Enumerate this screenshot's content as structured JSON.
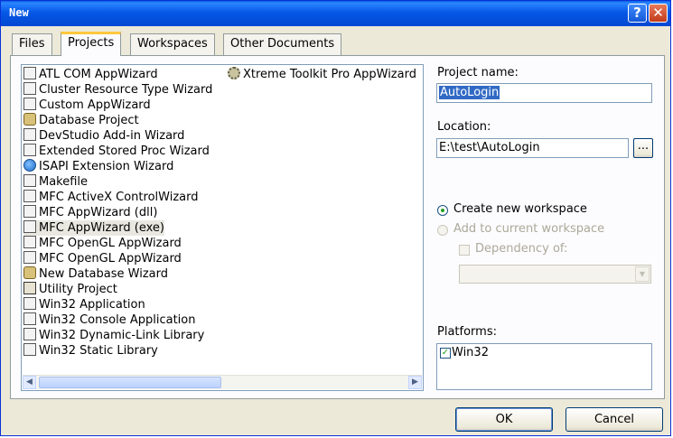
{
  "window": {
    "title": "New",
    "help_glyph": "?",
    "close_glyph": "✕"
  },
  "tabs": [
    {
      "label": "Files",
      "active": false
    },
    {
      "label": "Projects",
      "active": true
    },
    {
      "label": "Workspaces",
      "active": false
    },
    {
      "label": "Other Documents",
      "active": false
    }
  ],
  "project_types": [
    {
      "label": "ATL COM AppWizard",
      "icon": "atl-icon"
    },
    {
      "label": "Cluster Resource Type Wizard",
      "icon": "cluster-icon"
    },
    {
      "label": "Custom AppWizard",
      "icon": "custom-wizard-icon"
    },
    {
      "label": "Database Project",
      "icon": "database-icon"
    },
    {
      "label": "DevStudio Add-in Wizard",
      "icon": "addin-icon"
    },
    {
      "label": "Extended Stored Proc Wizard",
      "icon": "stored-proc-icon"
    },
    {
      "label": "ISAPI Extension Wizard",
      "icon": "globe-icon"
    },
    {
      "label": "Makefile",
      "icon": "makefile-icon"
    },
    {
      "label": "MFC ActiveX ControlWizard",
      "icon": "activex-icon"
    },
    {
      "label": "MFC AppWizard (dll)",
      "icon": "mfc-dll-icon"
    },
    {
      "label": "MFC AppWizard (exe)",
      "icon": "mfc-exe-icon",
      "selected": true
    },
    {
      "label": "MFC OpenGL AppWizard",
      "icon": "opengl-icon"
    },
    {
      "label": "MFC OpenGL AppWizard",
      "icon": "opengl-icon"
    },
    {
      "label": "New Database Wizard",
      "icon": "new-db-icon"
    },
    {
      "label": "Utility Project",
      "icon": "utility-icon"
    },
    {
      "label": "Win32 Application",
      "icon": "win32-app-icon"
    },
    {
      "label": "Win32 Console Application",
      "icon": "console-icon"
    },
    {
      "label": "Win32 Dynamic-Link Library",
      "icon": "dll-icon"
    },
    {
      "label": "Win32 Static Library",
      "icon": "lib-icon"
    },
    {
      "label": "Xtreme Toolkit Pro AppWizard",
      "icon": "gear-icon"
    }
  ],
  "project_name": {
    "label": "Project name:",
    "value": "AutoLogin"
  },
  "location": {
    "label": "Location:",
    "value": "E:\\test\\AutoLogin",
    "browse_label": "..."
  },
  "workspace": {
    "create_label": "Create new workspace",
    "add_label": "Add to current workspace",
    "dependency_label": "Dependency of:",
    "selected": "create"
  },
  "platforms": {
    "label": "Platforms:",
    "items": [
      {
        "label": "Win32",
        "checked": true
      }
    ]
  },
  "buttons": {
    "ok": "OK",
    "cancel": "Cancel"
  }
}
